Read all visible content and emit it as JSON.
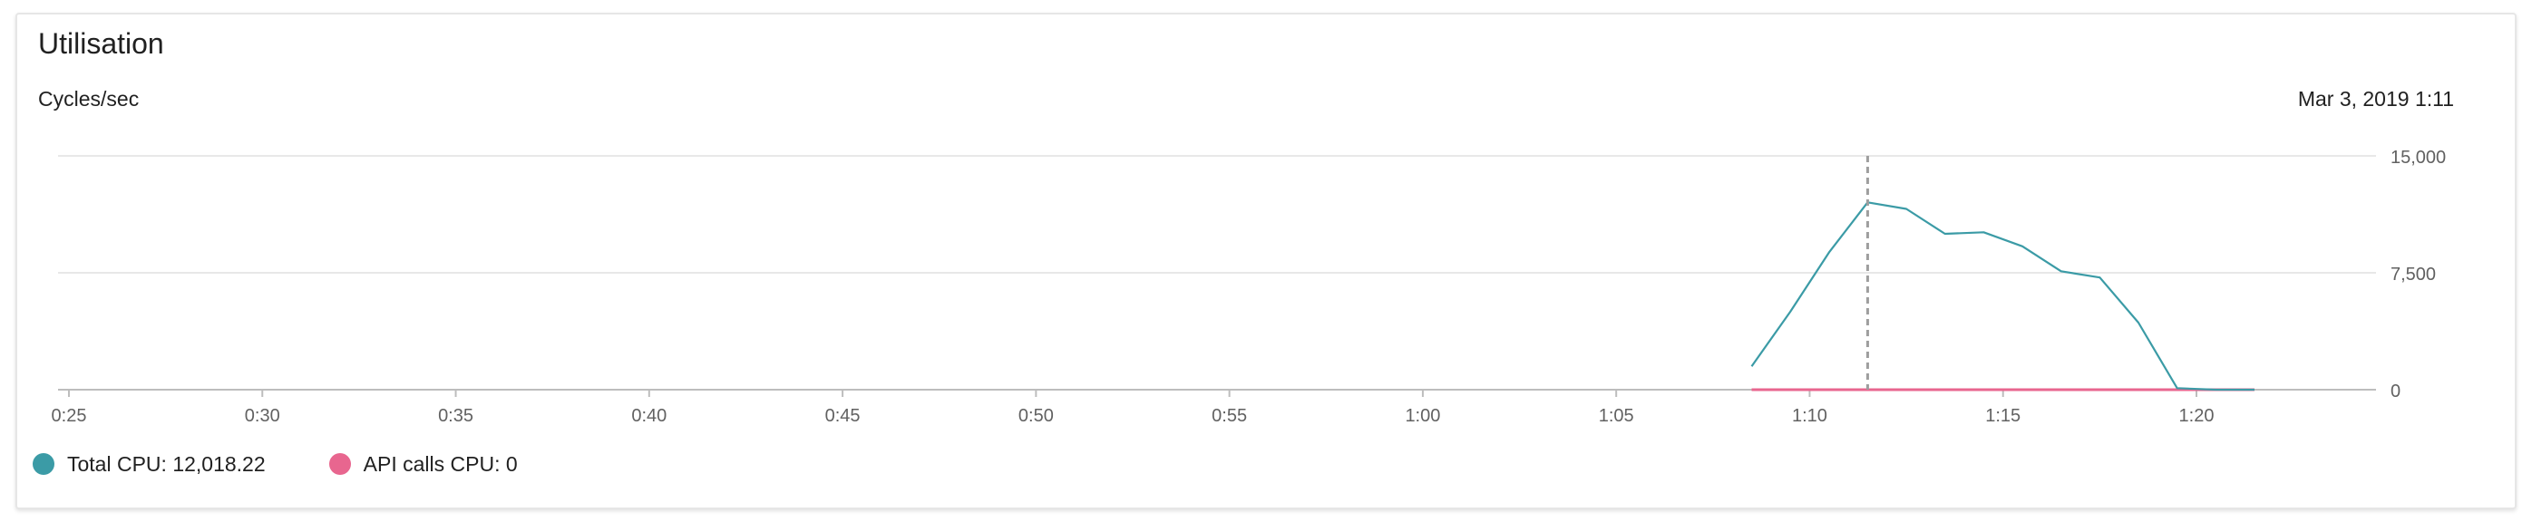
{
  "card": {
    "title": "Utilisation",
    "timestamp": "Mar 3, 2019 1:11"
  },
  "colors": {
    "total_cpu": "#3b9ba6",
    "api_calls_cpu": "#e8668f",
    "grid": "#e0e0e0",
    "axis": "#bdbdbd",
    "hover_line": "#9e9e9e",
    "label": "#616161"
  },
  "chart_data": {
    "type": "line",
    "title": "",
    "ylabel": "Cycles/sec",
    "xlabel": "",
    "x_tick_labels": [
      "0:25",
      "0:30",
      "0:35",
      "0:40",
      "0:45",
      "0:50",
      "0:55",
      "1:00",
      "1:05",
      "1:10",
      "1:15",
      "1:20"
    ],
    "x_tick_minutes": [
      25,
      30,
      35,
      40,
      45,
      50,
      55,
      60,
      65,
      70,
      75,
      80
    ],
    "xlim_minutes": [
      25,
      84.5
    ],
    "y_tick_labels": [
      "15,000",
      "7,500",
      "0"
    ],
    "y_tick_values": [
      15000,
      7500,
      0
    ],
    "ylim": [
      0,
      15000
    ],
    "grid": true,
    "hover_minute": 71.5,
    "series": [
      {
        "name": "Total CPU",
        "legend_value": "12,018.22",
        "color": "#3b9ba6",
        "x_minutes": [
          68.5,
          69.5,
          70.5,
          71.5,
          72.5,
          73.5,
          74.5,
          75.5,
          76.5,
          77.5,
          78.5,
          79.5,
          80.5,
          81.5
        ],
        "values": [
          1500,
          5000,
          8800,
          12018.22,
          11600,
          10000,
          10100,
          9200,
          7600,
          7200,
          4300,
          100,
          0,
          0
        ]
      },
      {
        "name": "API calls CPU",
        "legend_value": "0",
        "color": "#e8668f",
        "x_minutes": [
          68.5,
          81.5
        ],
        "values": [
          0,
          0
        ]
      }
    ],
    "legend_position": "bottom-left"
  }
}
